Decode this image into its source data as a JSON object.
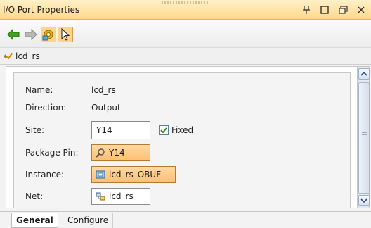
{
  "window": {
    "title": "I/O Port Properties"
  },
  "title_controls": {
    "pin_icon": "pin-icon",
    "maximize_icon": "maximize-icon",
    "restore_icon": "restore-icon",
    "close_icon": "close-icon"
  },
  "toolbar": {
    "buttons": [
      {
        "name": "back",
        "icon": "back-arrow-icon"
      },
      {
        "name": "forward",
        "icon": "forward-arrow-icon"
      },
      {
        "name": "auto-update",
        "icon": "gear-icon",
        "toggled": true
      },
      {
        "name": "select",
        "icon": "cursor-icon",
        "toggled": true
      }
    ]
  },
  "breadcrumb": {
    "label": "lcd_rs"
  },
  "properties": {
    "name_label": "Name:",
    "name_value": "lcd_rs",
    "direction_label": "Direction:",
    "direction_value": "Output",
    "site_label": "Site:",
    "site_value": "Y14",
    "fixed_label": "Fixed",
    "fixed_checked": true,
    "package_pin_label": "Package Pin:",
    "package_pin_value": "Y14",
    "instance_label": "Instance:",
    "instance_value": "lcd_rs_OBUF",
    "net_label": "Net:",
    "net_value": "lcd_rs"
  },
  "tabs": [
    {
      "label": "General",
      "active": true
    },
    {
      "label": "Configure",
      "active": false
    }
  ],
  "colors": {
    "title_bar": "#ffd98a",
    "chip_accent": "#ffbf72",
    "checkbox_check": "#2f8a1e"
  }
}
